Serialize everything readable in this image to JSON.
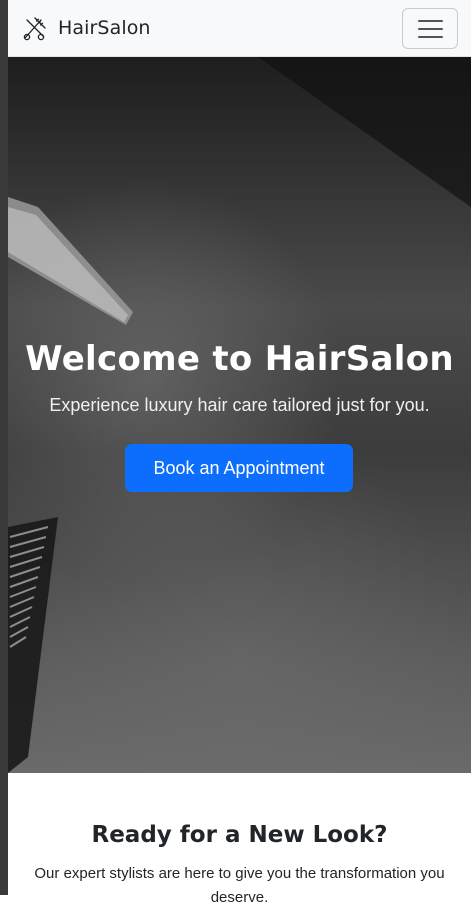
{
  "navbar": {
    "brand": "HairSalon",
    "logo_icon": "scissors-comb-icon",
    "menu_icon": "hamburger-menu-icon"
  },
  "hero": {
    "title": "Welcome to HairSalon",
    "subtitle": "Experience luxury hair care tailored just for you.",
    "cta_label": "Book an Appointment"
  },
  "cta_section": {
    "title": "Ready for a New Look?",
    "text": "Our expert stylists are here to give you the transformation you deserve."
  },
  "colors": {
    "primary": "#0d6efd",
    "navbar_bg": "#f8f9fa",
    "hero_text": "#ffffff"
  }
}
